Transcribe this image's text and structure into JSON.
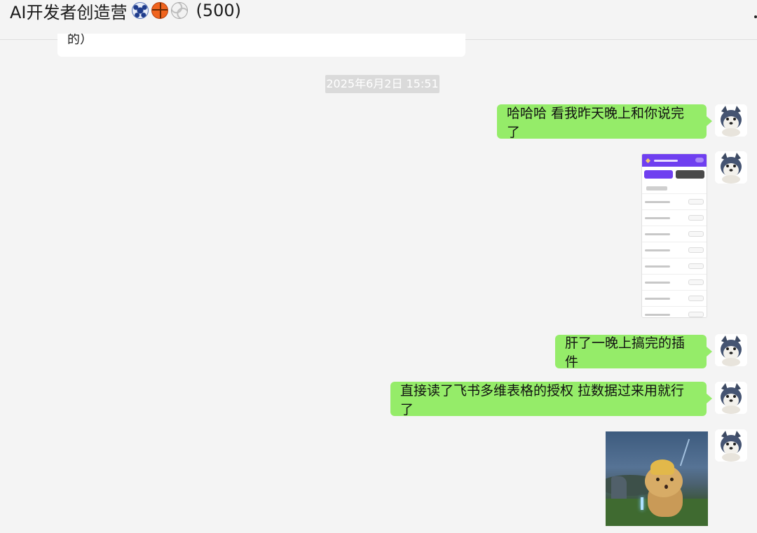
{
  "header": {
    "title": "AI开发者创造营",
    "emoji_icons": [
      "soccer-ball-icon",
      "basketball-icon",
      "volleyball-icon"
    ],
    "member_count": "(500)"
  },
  "previous_message": {
    "text": "的）"
  },
  "timestamp": "2025年6月2日 15:51",
  "messages": [
    {
      "type": "text",
      "text": "哈哈哈 看我昨天晚上和你说完了"
    },
    {
      "type": "image",
      "image": "plugin-screenshot-thumbnail"
    },
    {
      "type": "text",
      "text": "肝了一晚上搞完的插件"
    },
    {
      "type": "text",
      "text": "直接读了飞书多维表格的授权 拉数据过来用就行了"
    },
    {
      "type": "image",
      "image": "cat-gif-thumbnail"
    }
  ],
  "colors": {
    "chat_background": "#f4f4f4",
    "sent_bubble": "#95ec69",
    "timestamp_background": "#dadada",
    "plugin_accent": "#6f3ff0"
  }
}
